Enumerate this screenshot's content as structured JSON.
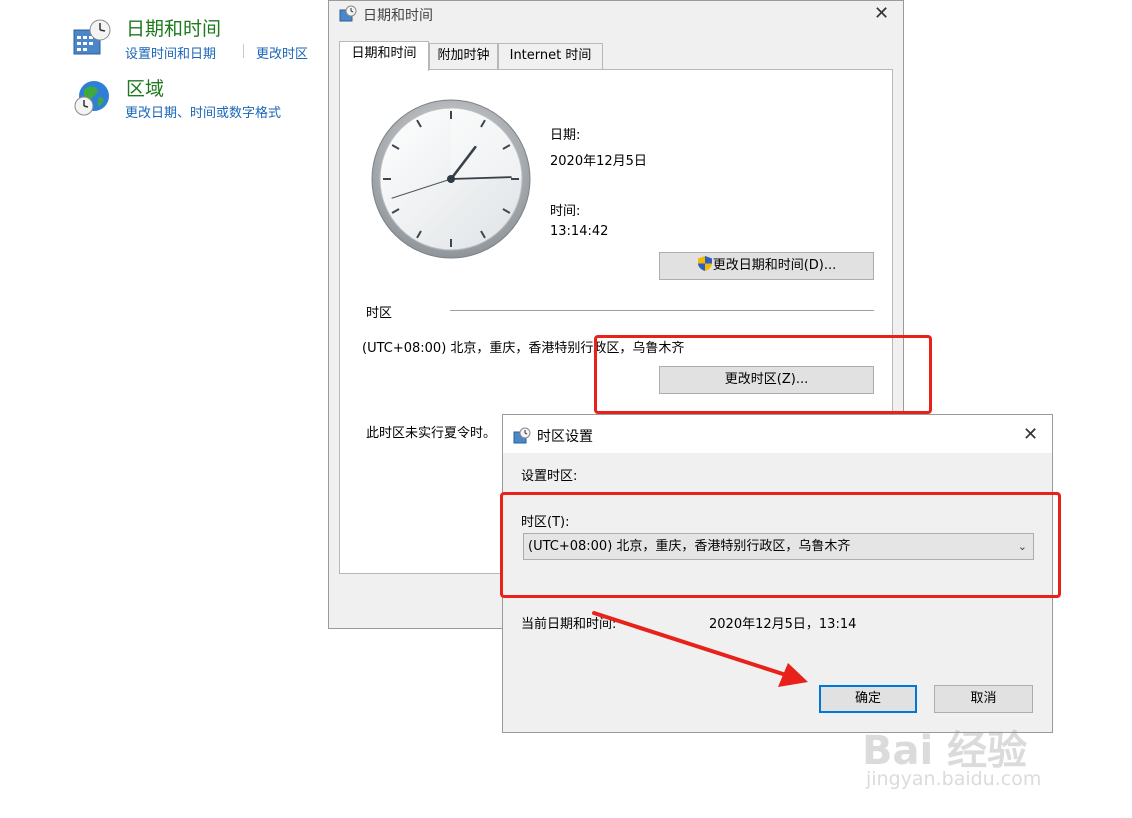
{
  "control_panel": {
    "datetime": {
      "title": "日期和时间",
      "link_set": "设置时间和日期",
      "link_tz": "更改时区"
    },
    "region": {
      "title": "区域",
      "link_formats": "更改日期、时间或数字格式"
    }
  },
  "main_dialog": {
    "title": "日期和时间",
    "tabs": [
      "日期和时间",
      "附加时钟",
      "Internet 时间"
    ],
    "date_label": "日期:",
    "date_value": "2020年12月5日",
    "time_label": "时间:",
    "time_value": "13:14:42",
    "change_datetime_button": "更改日期和时间(D)...",
    "timezone_group_label": "时区",
    "timezone_value": "(UTC+08:00) 北京，重庆，香港特别行政区，乌鲁木齐",
    "change_timezone_button": "更改时区(Z)...",
    "dst_note": "此时区未实行夏令时。",
    "clock": {
      "hour": 13,
      "minute": 14,
      "second": 42
    }
  },
  "tz_dialog": {
    "title": "时区设置",
    "set_timezone_label": "设置时区:",
    "timezone_field_label": "时区(T):",
    "timezone_selected": "(UTC+08:00) 北京，重庆，香港特别行政区，乌鲁木齐",
    "current_datetime_label": "当前日期和时间:",
    "current_datetime_value": "2020年12月5日，13:14",
    "ok_button": "确定",
    "cancel_button": "取消"
  },
  "watermark": {
    "brand": "Bai 经验",
    "url": "jingyan.baidu.com"
  },
  "colors": {
    "annotation_red": "#e8221b",
    "link_blue": "#1a66b8",
    "title_green": "#1e7a1e",
    "dialog_gray": "#f0f0f0"
  }
}
